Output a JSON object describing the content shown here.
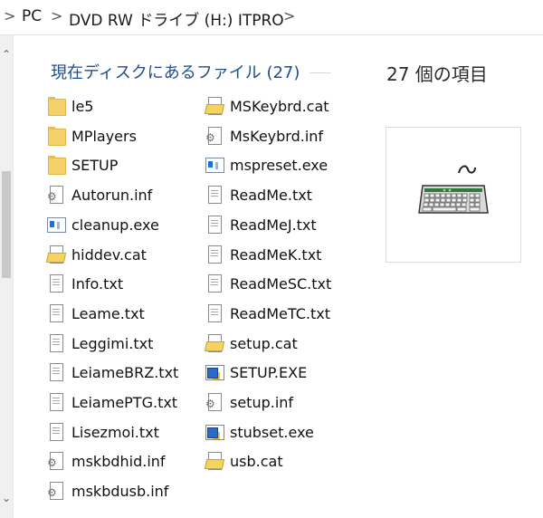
{
  "breadcrumb": {
    "items": [
      "PC",
      "DVD RW ドライブ (H:) ITPRO"
    ],
    "separator": ">"
  },
  "file_list": {
    "group_header": "現在ディスクにあるファイル (27)",
    "files": [
      {
        "name": "le5",
        "icon": "folder-icon"
      },
      {
        "name": "MPlayers",
        "icon": "folder-icon"
      },
      {
        "name": "SETUP",
        "icon": "folder-icon"
      },
      {
        "name": "Autorun.inf",
        "icon": "inf-file-icon"
      },
      {
        "name": "cleanup.exe",
        "icon": "exe-file-icon"
      },
      {
        "name": "hiddev.cat",
        "icon": "cat-file-icon"
      },
      {
        "name": "Info.txt",
        "icon": "text-file-icon"
      },
      {
        "name": "Leame.txt",
        "icon": "text-file-icon"
      },
      {
        "name": "Leggimi.txt",
        "icon": "text-file-icon"
      },
      {
        "name": "LeiameBRZ.txt",
        "icon": "text-file-icon"
      },
      {
        "name": "LeiamePTG.txt",
        "icon": "text-file-icon"
      },
      {
        "name": "Lisezmoi.txt",
        "icon": "text-file-icon"
      },
      {
        "name": "mskbdhid.inf",
        "icon": "inf-file-icon"
      },
      {
        "name": "mskbdusb.inf",
        "icon": "inf-file-icon"
      },
      {
        "name": "MSKeybrd.cat",
        "icon": "cat-file-icon"
      },
      {
        "name": "MsKeybrd.inf",
        "icon": "inf-file-icon"
      },
      {
        "name": "mspreset.exe",
        "icon": "exe-file-icon"
      },
      {
        "name": "ReadMe.txt",
        "icon": "text-file-icon"
      },
      {
        "name": "ReadMeJ.txt",
        "icon": "text-file-icon"
      },
      {
        "name": "ReadMeK.txt",
        "icon": "text-file-icon"
      },
      {
        "name": "ReadMeSC.txt",
        "icon": "text-file-icon"
      },
      {
        "name": "ReadMeTC.txt",
        "icon": "text-file-icon"
      },
      {
        "name": "setup.cat",
        "icon": "cat-file-icon"
      },
      {
        "name": "SETUP.EXE",
        "icon": "setup-exe-icon"
      },
      {
        "name": "setup.inf",
        "icon": "inf-file-icon"
      },
      {
        "name": "stubset.exe",
        "icon": "setup-exe-icon"
      },
      {
        "name": "usb.cat",
        "icon": "cat-file-icon"
      }
    ]
  },
  "details_pane": {
    "item_count": "27 個の項目",
    "preview_icon": "keyboard-icon"
  },
  "nav_scrollbar": {
    "up_arrow": "^",
    "down_arrow": "v"
  },
  "colors": {
    "group_header": "#1e4e8c",
    "folder": "#f6d06a",
    "background": "#ffffff"
  }
}
